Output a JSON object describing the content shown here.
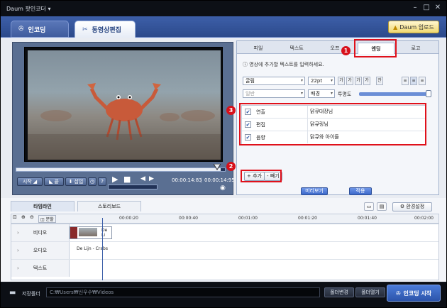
{
  "window": {
    "title": "Daum 팟인코더 ▾"
  },
  "modes": {
    "encode_label": "인코딩",
    "edit_label": "동영상편집",
    "update_label": "Daum 업로드"
  },
  "player": {
    "buttons": {
      "start": "시작",
      "end": "끝",
      "insert": "삽입",
      "help": "?"
    },
    "time_current": "00:00:14:83",
    "time_total": "00:00:14:95"
  },
  "props": {
    "tabs": [
      "피일",
      "텍스트",
      "오프",
      "앤딩",
      "로고"
    ],
    "active_tab": "앤딩",
    "hint": "영상에 추가할 텍스트를 입력하세요.",
    "font": "굴림",
    "size": "22pt",
    "style": "일반",
    "bg_label": "배경",
    "opacity_label": "투명도",
    "opacity_value": 1.0,
    "format_buttons": [
      "가",
      "가",
      "가",
      "가",
      "잔"
    ],
    "credits": [
      {
        "checked": true,
        "role": "연출",
        "name": "닭큐대장님"
      },
      {
        "checked": true,
        "role": "편집",
        "name": "닭큐링님"
      },
      {
        "checked": true,
        "role": "음향",
        "name": "닭큐와 아이들"
      }
    ],
    "add_label": "+ 추가",
    "remove_label": "- 빼기",
    "preview_label": "미리보기",
    "apply_label": "적용"
  },
  "annotations": {
    "badge1": "1",
    "badge2": "2",
    "badge3": "3"
  },
  "timeline": {
    "tabs": [
      "타임라인",
      "스토리보드"
    ],
    "split_label": "분할",
    "env_label": "환경설정",
    "ruler": [
      "00:00:20",
      "00:00:40",
      "00:01:00",
      "00:01:20",
      "00:01:40",
      "00:02:00"
    ],
    "tracks": [
      {
        "label": "비디오",
        "clip": "De Li"
      },
      {
        "label": "오디오",
        "clip": "De Lijn - Crabs"
      },
      {
        "label": "텍스트",
        "clip": ""
      }
    ]
  },
  "footer": {
    "folder_label": "저장폴더",
    "path": "C:₩Users₩신우수₩Videos",
    "change_label": "폴더변경",
    "open_label": "폴더열기",
    "start_label": "인코딩 시작"
  },
  "colors": {
    "accent": "#2c4a8b",
    "highlight": "#e0101a",
    "apply": "#3b68c9"
  }
}
